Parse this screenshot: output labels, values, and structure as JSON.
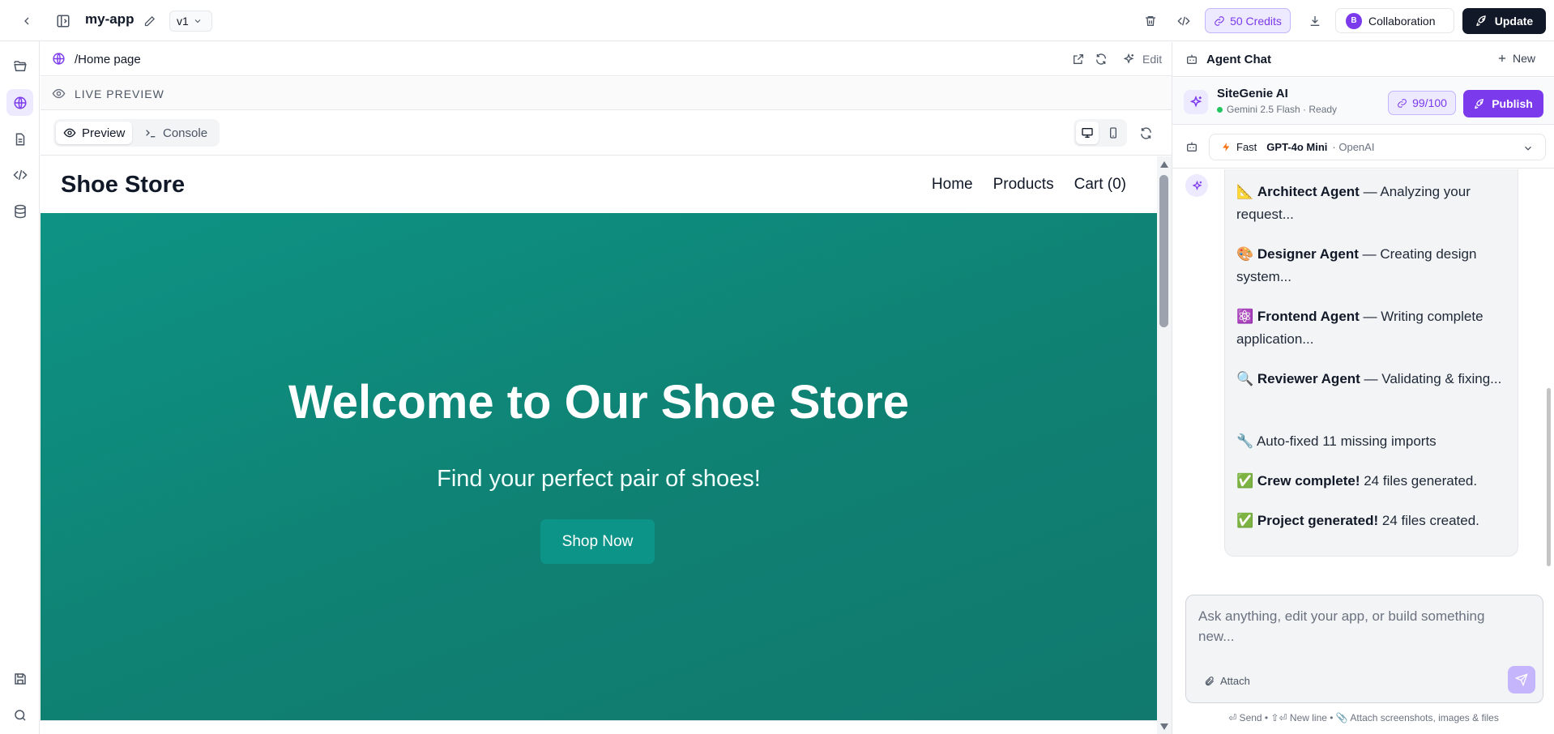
{
  "topbar": {
    "app_name": "my-app",
    "version": "v1",
    "credits": "50 Credits",
    "collab_avatar": "B",
    "collab_label": "Collaboration",
    "update_label": "Update"
  },
  "preview": {
    "url": "/Home page",
    "edit_label": "Edit",
    "live_label": "LIVE PREVIEW",
    "tabs": [
      {
        "label": "Preview",
        "active": true
      },
      {
        "label": "Console",
        "active": false
      }
    ]
  },
  "site": {
    "logo": "Shoe Store",
    "nav": [
      "Home",
      "Products",
      "Cart (0)"
    ],
    "hero_title": "Welcome to Our Shoe Store",
    "hero_subtitle": "Find your perfect pair of shoes!",
    "cta": "Shop Now",
    "hero_color": "#0f8173"
  },
  "panel": {
    "title": "Agent Chat",
    "new_label": "New",
    "agent_name": "SiteGenie AI",
    "agent_status": "Gemini 2.5 Flash · Ready",
    "quota": "99/100",
    "publish_label": "Publish",
    "model": {
      "speed": "Fast",
      "name": "GPT-4o Mini",
      "provider": "· OpenAI"
    },
    "messages": [
      {
        "emoji": "📐",
        "bold": "Architect Agent",
        "text": " — Analyzing your request..."
      },
      {
        "emoji": "🎨",
        "bold": "Designer Agent",
        "text": " — Creating design system..."
      },
      {
        "emoji": "⚛️",
        "bold": "Frontend Agent",
        "text": " — Writing complete application..."
      },
      {
        "emoji": "🔍",
        "bold": "Reviewer Agent",
        "text": " — Validating & fixing..."
      },
      {
        "emoji": "🔧",
        "bold": "",
        "text": "Auto-fixed 11 missing imports"
      },
      {
        "emoji": "✅",
        "bold": "Crew complete!",
        "text": " 24 files generated."
      },
      {
        "emoji": "✅",
        "bold": "Project generated!",
        "text": " 24 files created."
      }
    ],
    "composer_placeholder": "Ask anything, edit your app, or build something new...",
    "attach_label": "Attach",
    "hints": "⏎ Send • ⇧⏎ New line • 📎 Attach screenshots, images & files"
  },
  "colors": {
    "accent": "#7c3aed",
    "accent_soft": "#ede9fe",
    "dark_button": "#111827",
    "hero_teal": "#0f8173"
  },
  "icons": [
    "back-icon",
    "sidebar-toggle-icon",
    "pencil-icon",
    "chevron-down-icon",
    "trash-icon",
    "code-icon",
    "link-icon",
    "download-icon",
    "rocket-icon",
    "folder-icon",
    "globe-icon",
    "file-icon",
    "database-icon",
    "save-icon",
    "search-icon",
    "external-link-icon",
    "refresh-icon",
    "sparkles-icon",
    "eye-icon",
    "terminal-icon",
    "monitor-icon",
    "phone-icon",
    "bot-icon",
    "plus-icon",
    "bolt-icon",
    "paperclip-icon",
    "send-icon"
  ]
}
